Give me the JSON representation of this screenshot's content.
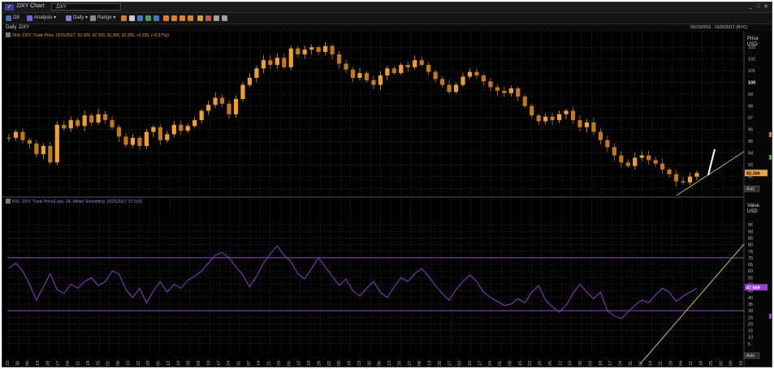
{
  "window": {
    "title": ".DXY Chart",
    "symbol_input": ".DXY",
    "controls": [
      "_",
      "□",
      "✕"
    ]
  },
  "toolbar": {
    "items": [
      {
        "label": "D8",
        "icon": "calendar-icon"
      },
      {
        "label": "Analysis ▾",
        "icon": "analysis-icon"
      },
      {
        "label": "Daily ▾",
        "icon": "interval-icon"
      },
      {
        "label": "Range ▾",
        "icon": "range-icon"
      }
    ]
  },
  "info": {
    "chart_label": "Daily .DXY",
    "date_range": "05/23/2016 - 10/20/2017 (NYC)"
  },
  "colors": {
    "price_up": "#f0a030",
    "price_down": "#c27a16",
    "rsi_line": "#8f3bd0",
    "rsi_bands": "#9a40d8",
    "trend_line": "#c9c236",
    "annotation": "#ffffff",
    "price_tag": "#f2a335",
    "rsi_tag": "#9a40d8",
    "grid": "#333333",
    "background": "#000000"
  },
  "chart_data": [
    {
      "type": "candlestick",
      "legend": "Ohlc .DXY, Trade Price, (9/25/2017, 92.420, 92.393, 92.306, 92.306, +0.335, (+0.37%))",
      "axis_unit_label": "Price",
      "axis_currency": "USD",
      "yticks": [
        103,
        102,
        101,
        100,
        99,
        98,
        97,
        96,
        95,
        94,
        93,
        92,
        91
      ],
      "ylim": [
        90.6,
        103.5
      ],
      "last_value_label": "92.306",
      "side_button": "Auto",
      "close_series": [
        95.3,
        95.8,
        95.1,
        94.8,
        93.9,
        94.6,
        93.2,
        96.4,
        96.1,
        96.8,
        96.3,
        97.2,
        96.6,
        97.3,
        96.8,
        96.2,
        95.4,
        94.7,
        95.3,
        94.6,
        95.8,
        96.2,
        95.1,
        95.6,
        96.4,
        95.9,
        96.3,
        96.8,
        97.6,
        98.1,
        98.7,
        98.2,
        97.3,
        98.6,
        99.8,
        100.4,
        101.2,
        101.9,
        101.5,
        102.1,
        101.3,
        102.9,
        102.4,
        102.8,
        103.0,
        102.6,
        103.1,
        102.4,
        101.6,
        101.1,
        100.4,
        100.8,
        100.2,
        99.8,
        100.6,
        101.2,
        100.8,
        101.5,
        101.3,
        101.9,
        101.5,
        100.9,
        100.3,
        99.8,
        99.2,
        99.8,
        100.5,
        100.9,
        100.6,
        100.1,
        99.6,
        99.3,
        99.1,
        99.5,
        98.8,
        98.0,
        97.2,
        96.7,
        97.1,
        96.8,
        97.3,
        97.6,
        96.8,
        96.2,
        96.6,
        95.8,
        95.1,
        94.5,
        93.8,
        93.2,
        92.9,
        93.6,
        93.8,
        93.4,
        93.1,
        92.6,
        92.2,
        91.6,
        91.5,
        92.0,
        92.3
      ]
    },
    {
      "type": "line",
      "legend": "RSI, .DXY, Trade Price(Last), 14, Wilder Smoothing, (9/25/2017, 57.565)",
      "axis_unit_label": "Value",
      "axis_currency": "USD",
      "yticks": [
        95,
        90,
        85,
        80,
        75,
        70,
        65,
        60,
        55,
        50,
        45,
        40,
        35,
        30,
        25,
        20,
        15,
        10,
        5
      ],
      "ylim": [
        0,
        100
      ],
      "overbought": 70,
      "oversold": 30,
      "last_value_label": "47.669",
      "side_button": "Auto",
      "values": [
        62,
        66,
        60,
        50,
        38,
        48,
        58,
        46,
        43,
        50,
        47,
        52,
        55,
        49,
        52,
        60,
        58,
        46,
        40,
        47,
        36,
        45,
        52,
        44,
        50,
        47,
        53,
        56,
        60,
        66,
        72,
        74,
        70,
        63,
        57,
        48,
        56,
        66,
        73,
        79,
        72,
        67,
        58,
        54,
        62,
        70,
        63,
        56,
        49,
        54,
        45,
        41,
        47,
        52,
        44,
        40,
        48,
        55,
        52,
        58,
        62,
        56,
        49,
        43,
        38,
        46,
        52,
        57,
        52,
        44,
        40,
        37,
        34,
        35,
        39,
        36,
        44,
        49,
        38,
        33,
        29,
        34,
        43,
        50,
        44,
        39,
        44,
        30,
        26,
        24,
        29,
        34,
        38,
        36,
        42,
        47,
        44,
        37,
        41,
        44,
        47
      ]
    },
    {
      "type": "axis",
      "xtick_labels": [
        "23",
        "30",
        "06",
        "13",
        "20",
        "27",
        "04",
        "11",
        "18",
        "25",
        "01",
        "08",
        "15",
        "22",
        "29",
        "05",
        "12",
        "19",
        "26",
        "03",
        "10",
        "17",
        "24",
        "31",
        "07",
        "14",
        "21",
        "28",
        "05",
        "12",
        "19",
        "26",
        "02",
        "09",
        "16",
        "23",
        "30",
        "06",
        "13",
        "20",
        "27",
        "06",
        "13",
        "20",
        "27",
        "03",
        "10",
        "17",
        "24",
        "01",
        "08",
        "15",
        "22",
        "29",
        "05",
        "12",
        "19",
        "26",
        "03",
        "10",
        "17",
        "24",
        "31",
        "07",
        "14",
        "21",
        "28",
        "04",
        "11",
        "18",
        "25",
        "02",
        "09",
        "16"
      ]
    }
  ]
}
